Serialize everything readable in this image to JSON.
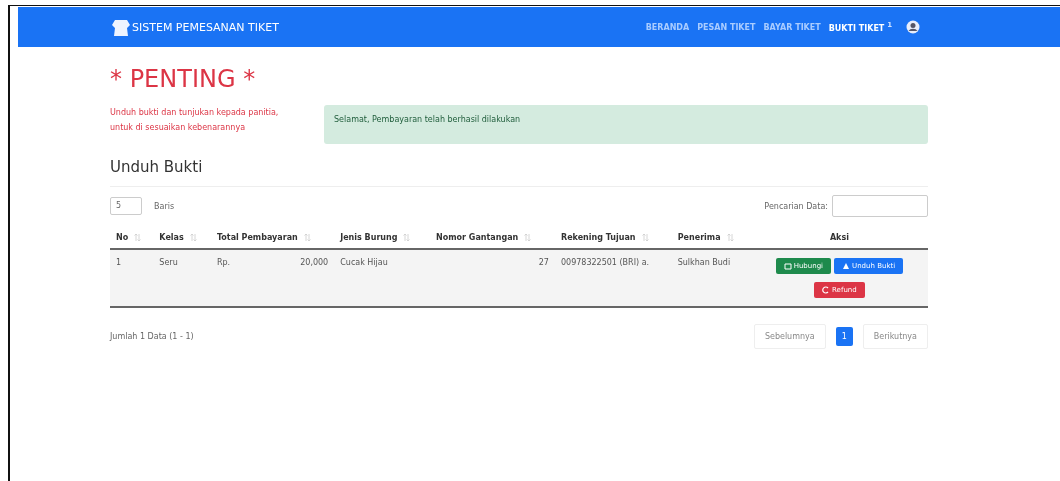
{
  "navbar": {
    "brand": "SISTEM PEMESANAN TIKET",
    "links": [
      {
        "label": "BERANDA",
        "selected": false
      },
      {
        "label": "PESAN TIKET",
        "selected": false
      },
      {
        "label": "BAYAR TIKET",
        "selected": false
      },
      {
        "label": "BUKTI TIKET",
        "selected": true,
        "badge": "1"
      }
    ]
  },
  "heading": "* PENTING *",
  "note": "Unduh bukti dan tunjukan kepada panitia, untuk di sesuaikan kebenarannya",
  "alert": "Selamat, Pembayaran telah berhasil dilakukan",
  "section_title": "Unduh Bukti",
  "length": {
    "value": "5",
    "label": "Baris"
  },
  "search": {
    "label": "Pencarian Data:"
  },
  "table": {
    "columns": [
      {
        "label": "No",
        "sortable": true
      },
      {
        "label": "Kelas",
        "sortable": true
      },
      {
        "label": "Total Pembayaran",
        "sortable": true
      },
      {
        "label": "Jenis Burung",
        "sortable": true
      },
      {
        "label": "Nomor Gantangan",
        "sortable": true
      },
      {
        "label": "Rekening Tujuan",
        "sortable": true
      },
      {
        "label": "Penerima",
        "sortable": true
      },
      {
        "label": "Aksi",
        "sortable": false
      }
    ],
    "rows": [
      {
        "no": "1",
        "kelas": "Seru",
        "currency": "Rp.",
        "total": "20,000",
        "jenis": "Cucak Hijau",
        "nomor": "27",
        "rekening": "00978322501 (BRI) a.",
        "penerima": "Sulkhan Budi",
        "actions": [
          {
            "kind": "success",
            "label": "Hubungi"
          },
          {
            "kind": "primary",
            "label": "Unduh Bukti"
          },
          {
            "kind": "danger",
            "label": "Refund"
          }
        ]
      }
    ]
  },
  "info": "Jumlah 1 Data (1 - 1)",
  "pagination": {
    "previous": "Sebelumnya",
    "pages": [
      {
        "label": "1",
        "selected": true
      }
    ],
    "next": "Berikutnya"
  }
}
